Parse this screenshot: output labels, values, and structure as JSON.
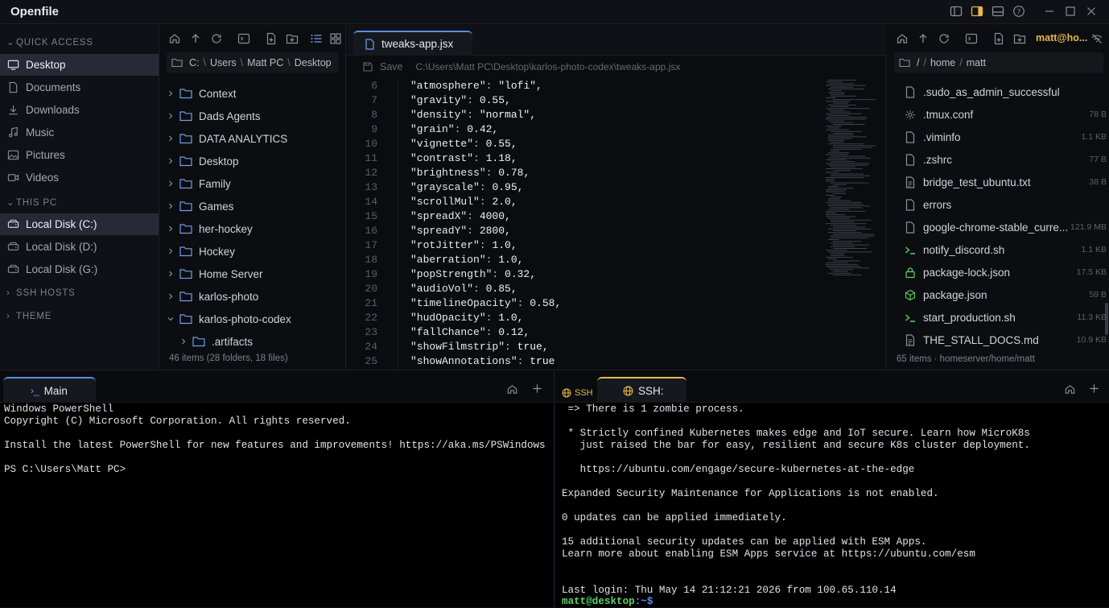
{
  "app": {
    "title": "Openfile"
  },
  "sidebar": {
    "quick_access_label": "QUICK ACCESS",
    "quick_access": [
      {
        "label": "Desktop",
        "icon": "monitor-icon",
        "active": true
      },
      {
        "label": "Documents",
        "icon": "document-icon"
      },
      {
        "label": "Downloads",
        "icon": "download-icon"
      },
      {
        "label": "Music",
        "icon": "music-icon"
      },
      {
        "label": "Pictures",
        "icon": "image-icon"
      },
      {
        "label": "Videos",
        "icon": "video-icon"
      }
    ],
    "this_pc_label": "THIS PC",
    "drives": [
      {
        "label": "Local Disk (C:)",
        "active": true
      },
      {
        "label": "Local Disk (D:)"
      },
      {
        "label": "Local Disk (G:)"
      }
    ],
    "ssh_hosts_label": "SSH HOSTS",
    "theme_label": "THEME"
  },
  "tree": {
    "breadcrumb": [
      "C:",
      "Users",
      "Matt PC",
      "Desktop"
    ],
    "items": [
      {
        "label": "Context"
      },
      {
        "label": "Dads Agents"
      },
      {
        "label": "DATA ANALYTICS"
      },
      {
        "label": "Desktop"
      },
      {
        "label": "Family"
      },
      {
        "label": "Games"
      },
      {
        "label": "her-hockey"
      },
      {
        "label": "Hockey"
      },
      {
        "label": "Home Server"
      },
      {
        "label": "karlos-photo"
      },
      {
        "label": "karlos-photo-codex",
        "expanded": true
      },
      {
        "label": ".artifacts",
        "indent": true
      }
    ],
    "status": "46 items (28 folders, 18 files)"
  },
  "editor": {
    "tab_label": "tweaks-app.jsx",
    "save_label": "Save",
    "path": "C:\\Users\\Matt PC\\Desktop\\karlos-photo-codex\\tweaks-app.jsx",
    "lines": [
      {
        "n": "6",
        "text": "\"atmosphere\": \"lofi\","
      },
      {
        "n": "7",
        "text": "\"gravity\": 0.55,"
      },
      {
        "n": "8",
        "text": "\"density\": \"normal\","
      },
      {
        "n": "9",
        "text": "\"grain\": 0.42,"
      },
      {
        "n": "10",
        "text": "\"vignette\": 0.55,"
      },
      {
        "n": "11",
        "text": "\"contrast\": 1.18,"
      },
      {
        "n": "12",
        "text": "\"brightness\": 0.78,"
      },
      {
        "n": "13",
        "text": "\"grayscale\": 0.95,"
      },
      {
        "n": "14",
        "text": "\"scrollMul\": 2.0,"
      },
      {
        "n": "15",
        "text": "\"spreadX\": 4000,"
      },
      {
        "n": "16",
        "text": "\"spreadY\": 2800,"
      },
      {
        "n": "17",
        "text": "\"rotJitter\": 1.0,"
      },
      {
        "n": "18",
        "text": "\"aberration\": 1.0,"
      },
      {
        "n": "19",
        "text": "\"popStrength\": 0.32,"
      },
      {
        "n": "20",
        "text": "\"audioVol\": 0.85,"
      },
      {
        "n": "21",
        "text": "\"timelineOpacity\": 0.58,"
      },
      {
        "n": "22",
        "text": "\"hudOpacity\": 1.0,"
      },
      {
        "n": "23",
        "text": "\"fallChance\": 0.12,"
      },
      {
        "n": "24",
        "text": "\"showFilmstrip\": true,"
      },
      {
        "n": "25",
        "text": "\"showAnnotations\": true"
      }
    ]
  },
  "remote": {
    "user_label": "matt@ho...",
    "breadcrumb": [
      "/",
      "home",
      "matt"
    ],
    "items": [
      {
        "label": ".sudo_as_admin_successful",
        "icon": "file-icon",
        "size": ""
      },
      {
        "label": ".tmux.conf",
        "icon": "gear-icon",
        "size": "78 B"
      },
      {
        "label": ".viminfo",
        "icon": "file-icon",
        "size": "1.1 KB"
      },
      {
        "label": ".zshrc",
        "icon": "file-icon",
        "size": "77 B"
      },
      {
        "label": "bridge_test_ubuntu.txt",
        "icon": "text-file-icon",
        "size": "38 B"
      },
      {
        "label": "errors",
        "icon": "file-icon",
        "size": ""
      },
      {
        "label": "google-chrome-stable_curre...",
        "icon": "file-icon",
        "size": "121.9 MB"
      },
      {
        "label": "notify_discord.sh",
        "icon": "terminal-file-icon",
        "size": "1.1 KB"
      },
      {
        "label": "package-lock.json",
        "icon": "lock-icon",
        "size": "17.5 KB"
      },
      {
        "label": "package.json",
        "icon": "package-icon",
        "size": "59 B"
      },
      {
        "label": "start_production.sh",
        "icon": "terminal-file-icon",
        "size": "11.3 KB"
      },
      {
        "label": "THE_STALL_DOCS.md",
        "icon": "text-file-icon",
        "size": "10.9 KB"
      }
    ],
    "status": "65 items · homeserver/home/matt"
  },
  "terminal_left": {
    "tab_label": "Main",
    "output": "Windows PowerShell\nCopyright (C) Microsoft Corporation. All rights reserved.\n\nInstall the latest PowerShell for new features and improvements! https://aka.ms/PSWindows\n\nPS C:\\Users\\Matt PC>"
  },
  "terminal_right": {
    "ssh_badge": "SSH",
    "tab_label": "SSH:",
    "output": " => There is 1 zombie process.\n\n * Strictly confined Kubernetes makes edge and IoT secure. Learn how MicroK8s\n   just raised the bar for easy, resilient and secure K8s cluster deployment.\n\n   https://ubuntu.com/engage/secure-kubernetes-at-the-edge\n\nExpanded Security Maintenance for Applications is not enabled.\n\n0 updates can be applied immediately.\n\n15 additional security updates can be applied with ESM Apps.\nLearn more about enabling ESM Apps service at https://ubuntu.com/esm\n\n\nLast login: Thu May 14 21:12:21 2026 from 100.65.110.14",
    "prompt_user": "matt@desktop",
    "prompt_path": ":~$"
  },
  "colors": {
    "accent": "#5a8cf0",
    "ssh_accent": "#e8b84a",
    "prompt_green": "#5fd068",
    "prompt_blue": "#5a8cf0"
  }
}
